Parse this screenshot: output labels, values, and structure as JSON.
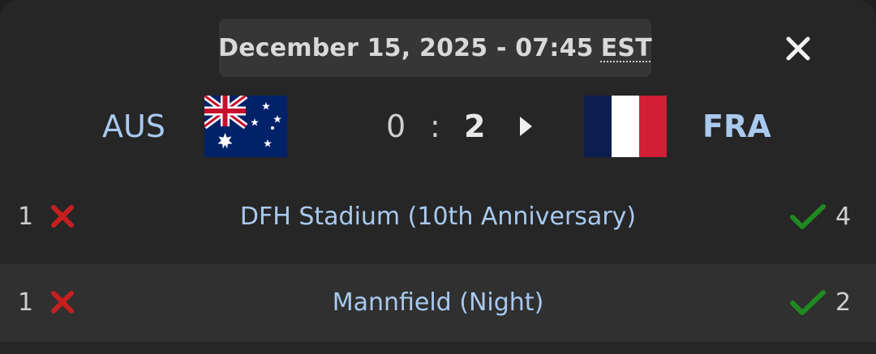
{
  "header": {
    "date": "December 15, 2025 - 07:45",
    "timezone": "EST"
  },
  "match": {
    "home": {
      "code": "AUS",
      "flag": "australia-flag-icon",
      "score": "0"
    },
    "away": {
      "code": "FRA",
      "flag": "france-flag-icon",
      "score": "2"
    },
    "separator": ":"
  },
  "maps": [
    {
      "name": "DFH Stadium (10th Anniversary)",
      "home_score": "1",
      "away_score": "4",
      "home_result": "loss",
      "away_result": "win"
    },
    {
      "name": "Mannfield (Night)",
      "home_score": "1",
      "away_score": "2",
      "home_result": "loss",
      "away_result": "win"
    }
  ],
  "colors": {
    "background": "#262626",
    "accent_text": "#a9c9ef",
    "loss": "#c61f1f",
    "win": "#1f8a1f"
  }
}
